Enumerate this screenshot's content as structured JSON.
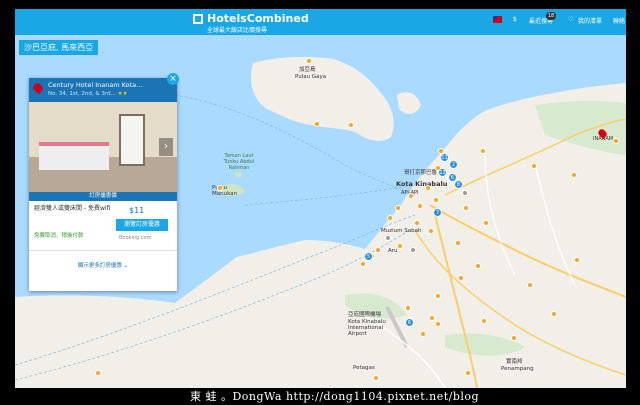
{
  "header": {
    "logo_name": "HotelsCombined",
    "logo_tagline": "全球最大飯店比價搜尋",
    "currency": "$",
    "recent_label": "最近搜尋",
    "recent_count": "18",
    "favorites_label": "我的清單",
    "more_label": "聯絡"
  },
  "map": {
    "location_label": "沙巴亞庇, 馬來西亞",
    "labels": {
      "gaya_island": "加亞島",
      "pulau_gaya": "Pulau Gaya",
      "marine_park": "Taman Laut Tunku Abdul Rahman",
      "manukan": "Pulau Manukan",
      "city_cn": "哥打京那巴魯",
      "kota_kinabalu": "Kota Kinabalu",
      "api_api": "API-API",
      "muzium": "Muzium Sabah",
      "aru": "Aru",
      "airport_cn": "亞庇國際機場",
      "airport": "Kota Kinabalu International Airport",
      "petagas": "Petagas",
      "penampang_cn": "實南邦",
      "penampang": "Penampang",
      "inanam": "INANAM"
    },
    "pin_numbers": [
      "11",
      "2",
      "13",
      "6",
      "8",
      "7",
      "5",
      "6"
    ]
  },
  "hotel_card": {
    "name": "Century Hotel Inanam Kota...",
    "address": "No. 34, 1st, 2nd, & 3rd...",
    "stars": "★★",
    "offer_header": "訂房優惠價",
    "room_type": "經濟雙人或雙床間 - 免費wifi",
    "price": "$11",
    "book_label": "瀏覽訂房優惠",
    "provider": "Booking.com",
    "free_cancel": "免費取消、稍後付款",
    "more_offers": "顯示更多訂房優惠"
  },
  "watermark": "東 蛙 。DongWa http://dong1104.pixnet.net/blog",
  "colors": {
    "brand_blue": "#1aa7e6",
    "dark_blue": "#1a74b6",
    "sea": "#aadaff",
    "land": "#f2efe9",
    "hotel_dot": "#f5a623",
    "pin_red": "#d0021b"
  }
}
